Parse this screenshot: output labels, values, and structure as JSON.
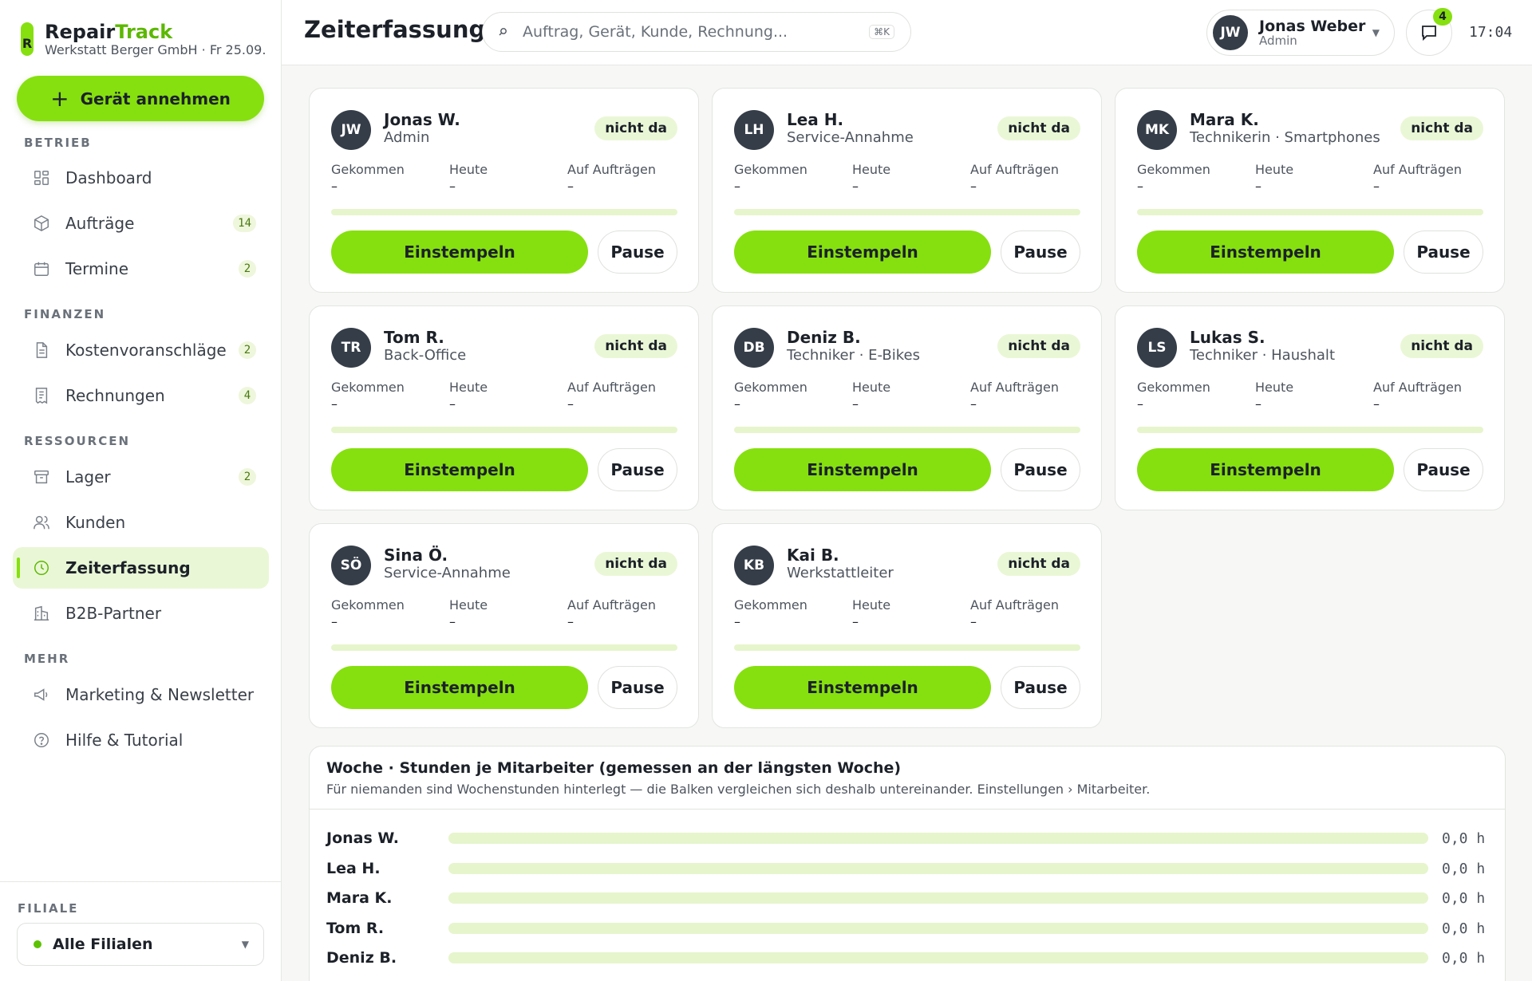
{
  "brand": {
    "name_part1": "Repair",
    "name_part2": "Track",
    "mark": "R",
    "subtitle": "Werkstatt Berger GmbH · Fr 25.09."
  },
  "cta": {
    "label": "Gerät annehmen"
  },
  "sidebar": {
    "sections": [
      {
        "label": "BETRIEB"
      },
      {
        "label": "FINANZEN"
      },
      {
        "label": "RESSOURCEN"
      },
      {
        "label": "MEHR"
      }
    ],
    "items": [
      {
        "label": "Dashboard",
        "icon": "dashboard-icon"
      },
      {
        "label": "Aufträge",
        "icon": "box-icon",
        "count": "14"
      },
      {
        "label": "Termine",
        "icon": "calendar-icon",
        "count": "2"
      },
      {
        "label": "Kostenvoranschläge",
        "icon": "document-icon",
        "count": "2"
      },
      {
        "label": "Rechnungen",
        "icon": "receipt-icon",
        "count": "4"
      },
      {
        "label": "Lager",
        "icon": "archive-icon",
        "count": "2"
      },
      {
        "label": "Kunden",
        "icon": "users-icon"
      },
      {
        "label": "Zeiterfassung",
        "icon": "clock-icon",
        "active": true
      },
      {
        "label": "B2B-Partner",
        "icon": "building-icon"
      },
      {
        "label": "Marketing & Newsletter",
        "icon": "megaphone-icon"
      },
      {
        "label": "Hilfe & Tutorial",
        "icon": "help-icon"
      }
    ],
    "branch": {
      "label": "FILIALE",
      "value": "Alle Filialen"
    }
  },
  "header": {
    "title": "Zeiterfassung",
    "search_placeholder": "Auftrag, Gerät, Kunde, Rechnung...",
    "search_shortcut": "⌘K",
    "user": {
      "initials": "JW",
      "name": "Jonas Weber",
      "role": "Admin"
    },
    "notifications": "4",
    "time": "17:04"
  },
  "card_labels": {
    "arrived": "Gekommen",
    "today": "Heute",
    "on_jobs": "Auf Aufträgen",
    "clock_in": "Einstempeln",
    "pause": "Pause"
  },
  "employees": [
    {
      "initials": "JW",
      "name": "Jonas W.",
      "role": "Admin",
      "status": "nicht da",
      "arrived": "–",
      "today": "–",
      "on_jobs": "–",
      "progress": 0
    },
    {
      "initials": "LH",
      "name": "Lea H.",
      "role": "Service-Annahme",
      "status": "nicht da",
      "arrived": "–",
      "today": "–",
      "on_jobs": "–",
      "progress": 0
    },
    {
      "initials": "MK",
      "name": "Mara K.",
      "role": "Technikerin · Smartphones",
      "status": "nicht da",
      "arrived": "–",
      "today": "–",
      "on_jobs": "–",
      "progress": 0
    },
    {
      "initials": "TR",
      "name": "Tom R.",
      "role": "Back-Office",
      "status": "nicht da",
      "arrived": "–",
      "today": "–",
      "on_jobs": "–",
      "progress": 0
    },
    {
      "initials": "DB",
      "name": "Deniz B.",
      "role": "Techniker · E-Bikes",
      "status": "nicht da",
      "arrived": "–",
      "today": "–",
      "on_jobs": "–",
      "progress": 0
    },
    {
      "initials": "LS",
      "name": "Lukas S.",
      "role": "Techniker · Haushalt",
      "status": "nicht da",
      "arrived": "–",
      "today": "–",
      "on_jobs": "–",
      "progress": 0
    },
    {
      "initials": "SÖ",
      "name": "Sina Ö.",
      "role": "Service-Annahme",
      "status": "nicht da",
      "arrived": "–",
      "today": "–",
      "on_jobs": "–",
      "progress": 0
    },
    {
      "initials": "KB",
      "name": "Kai B.",
      "role": "Werkstattleiter",
      "status": "nicht da",
      "arrived": "–",
      "today": "–",
      "on_jobs": "–",
      "progress": 0
    }
  ],
  "week": {
    "title": "Woche · Stunden je Mitarbeiter (gemessen an der längsten Woche)",
    "note": "Für niemanden sind Wochenstunden hinterlegt — die Balken vergleichen sich deshalb untereinander. Einstellungen › Mitarbeiter.",
    "rows": [
      {
        "name": "Jonas W.",
        "value": "0,0 h",
        "fraction": 0
      },
      {
        "name": "Lea H.",
        "value": "0,0 h",
        "fraction": 0
      },
      {
        "name": "Mara K.",
        "value": "0,0 h",
        "fraction": 0
      },
      {
        "name": "Tom R.",
        "value": "0,0 h",
        "fraction": 0
      },
      {
        "name": "Deniz B.",
        "value": "0,0 h",
        "fraction": 0
      }
    ]
  },
  "colors": {
    "accent": "#86e00f",
    "accent_soft": "#eaf7d6",
    "avatar": "#353d48",
    "text": "#1c2129"
  }
}
